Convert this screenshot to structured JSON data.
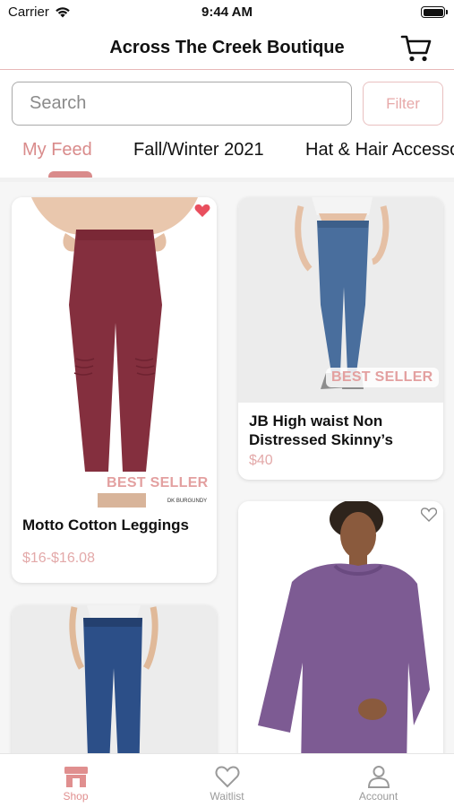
{
  "status_bar": {
    "carrier": "Carrier",
    "time": "9:44 AM"
  },
  "nav": {
    "title": "Across The Creek Boutique"
  },
  "search": {
    "placeholder": "Search",
    "filter_label": "Filter"
  },
  "category_tabs": [
    {
      "label": "My Feed",
      "active": true
    },
    {
      "label": "Fall/Winter 2021",
      "active": false
    },
    {
      "label": "Hat & Hair Accesso",
      "active": false
    }
  ],
  "products": [
    {
      "name": "Motto Cotton Leggings",
      "price": "$16-$16.08",
      "badge": "BEST SELLER",
      "favorited": true,
      "tag_text": "DK BURGUNDY"
    },
    {
      "name": "JB High waist Non Distressed Skinny’s",
      "price": "$40",
      "badge": "BEST SELLER",
      "favorited": false
    },
    {
      "name": "",
      "price": "",
      "badge": "",
      "favorited": false
    },
    {
      "name": "",
      "price": "",
      "badge": "",
      "favorited": false
    }
  ],
  "bottom_tabs": [
    {
      "label": "Shop",
      "icon": "store-icon",
      "active": true
    },
    {
      "label": "Waitlist",
      "icon": "heart-icon",
      "active": false
    },
    {
      "label": "Account",
      "icon": "person-icon",
      "active": false
    }
  ],
  "colors": {
    "accent": "#d98b8b",
    "price": "#e3a9a9",
    "heart_filled": "#e94f5e"
  }
}
